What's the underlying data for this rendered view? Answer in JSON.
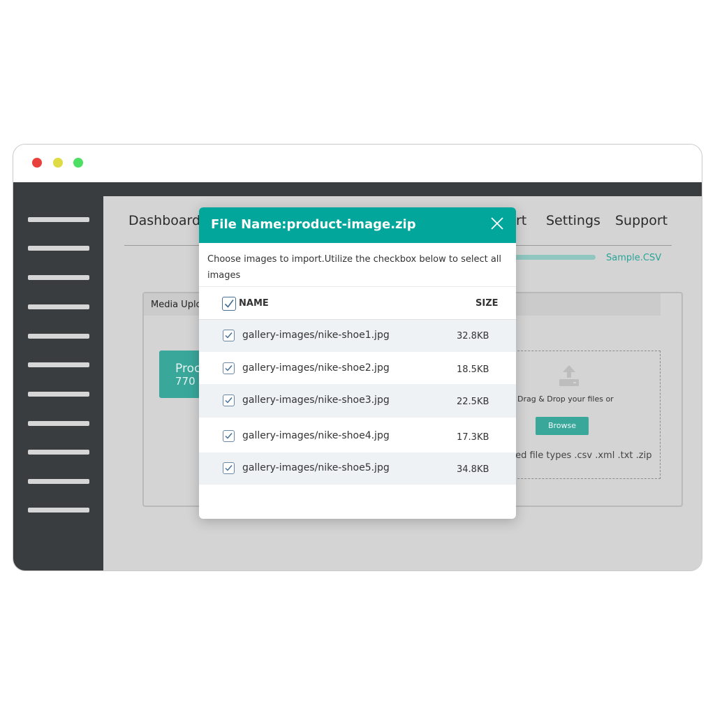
{
  "nav": {
    "dashboard": "Dashboard",
    "report": "rt",
    "settings": "Settings",
    "support": "Support"
  },
  "sample_link": "Sample.CSV",
  "panel": {
    "title": "Media Uplo",
    "product_card": {
      "line1": "Proc",
      "line2": "770"
    },
    "dropzone": {
      "text": "Drag & Drop your files or",
      "browse_label": "Browse",
      "file_types": "ted file types .csv .xml .txt .zip"
    }
  },
  "modal": {
    "title": "File Name:product-image.zip",
    "instructions": "Choose images to import.Utilize the checkbox below to select all images",
    "columns": {
      "name": "NAME",
      "size": "SIZE"
    },
    "files": [
      {
        "name": "gallery-images/nike-shoe1.jpg",
        "size": "32.8KB",
        "checked": true
      },
      {
        "name": "gallery-images/nike-shoe2.jpg",
        "size": "18.5KB",
        "checked": true
      },
      {
        "name": "gallery-images/nike-shoe3.jpg",
        "size": "22.5KB",
        "checked": true
      },
      {
        "name": "gallery-images/nike-shoe4.jpg",
        "size": "17.3KB",
        "checked": true
      },
      {
        "name": "gallery-images/nike-shoe5.jpg",
        "size": "34.8KB",
        "checked": true
      }
    ]
  },
  "colors": {
    "accent": "#03a69a",
    "sidebar": "#3a3d40",
    "background": "#d4d4d4"
  }
}
